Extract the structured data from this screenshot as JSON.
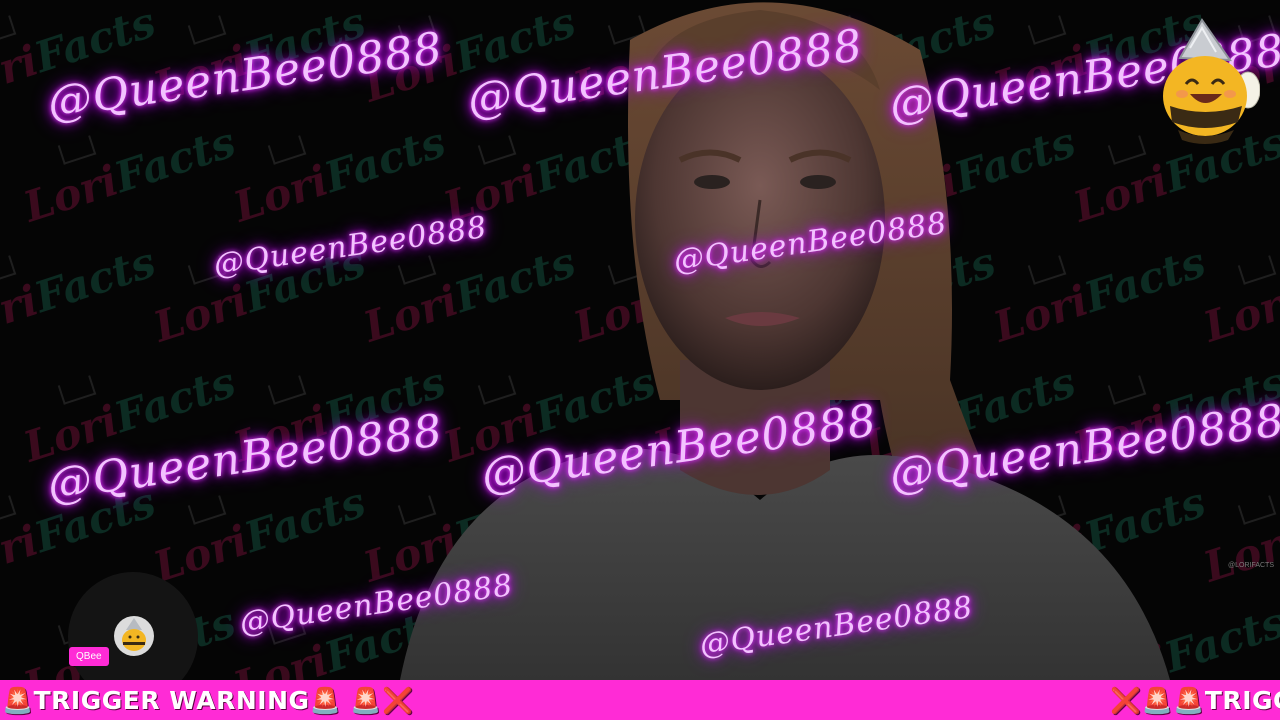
{
  "watermark": {
    "handle": "@QueenBee0888"
  },
  "background": {
    "brand_a": "Lori",
    "brand_b": "Facts",
    "colors": {
      "brand_pink": "#c2185b",
      "brand_teal": "#1f8f6f",
      "neon": "#d500f9"
    }
  },
  "sticker": {
    "icon": "bee-with-tinfoil-hat-icon"
  },
  "creator": {
    "tag_label": "QBee",
    "avatar_icon": "bee-avatar-icon"
  },
  "corner_watermark": "@LORIFACTS",
  "ticker": {
    "left_text": "🚨TRIGGER WARNING🚨 🚨❌",
    "right_text": "❌🚨🚨TRIGG",
    "background_color": "#ff2bd6"
  }
}
